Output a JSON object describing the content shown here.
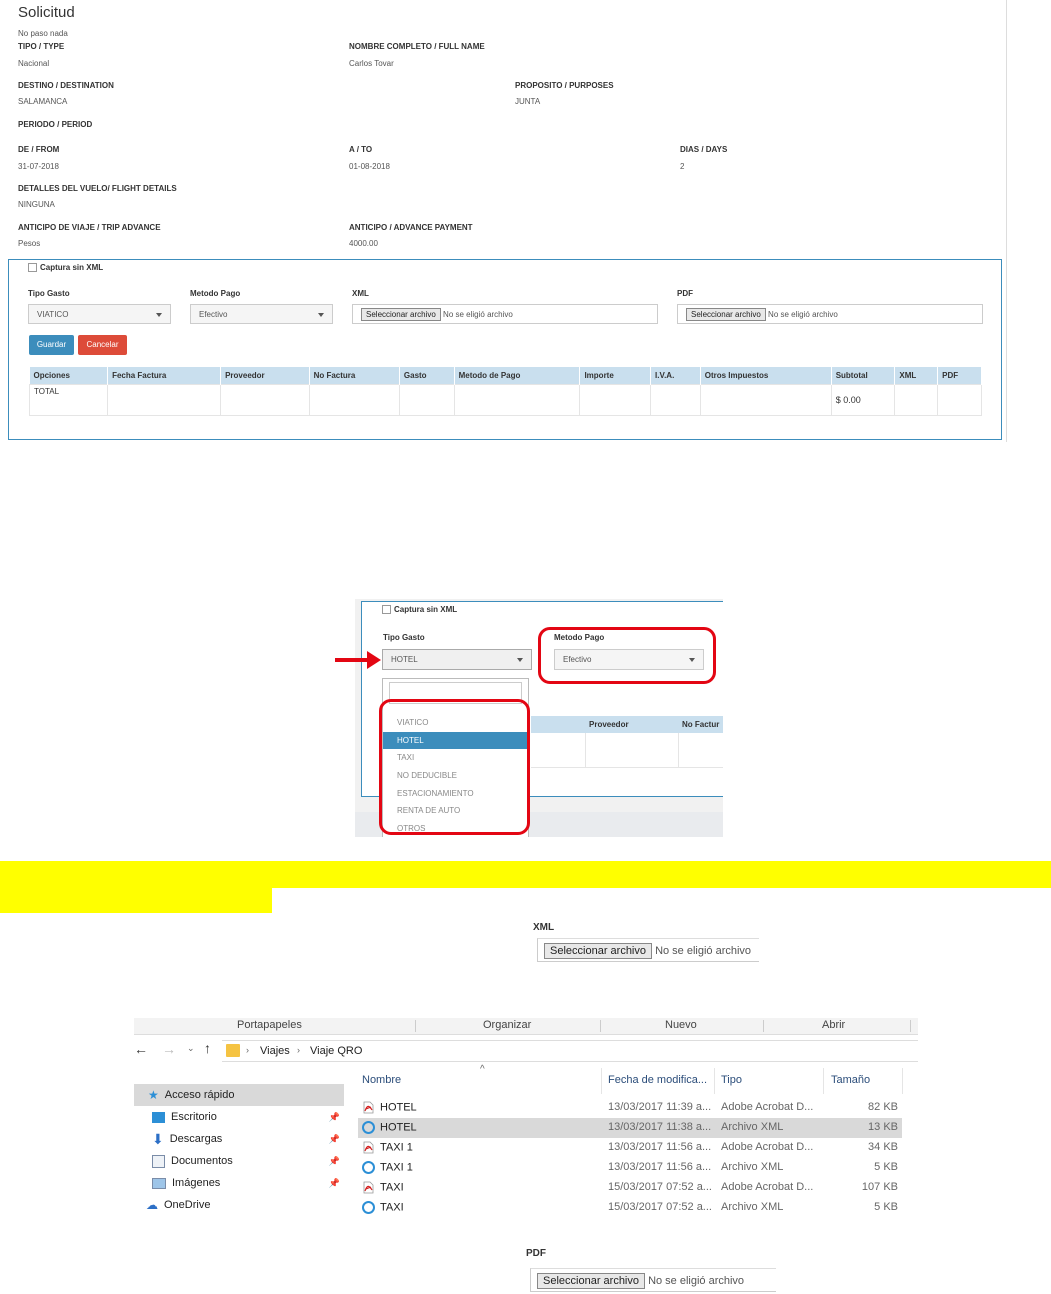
{
  "form": {
    "title": "Solicitud",
    "note": "No paso nada",
    "fields": {
      "type_label": "TIPO / TYPE",
      "type_value": "Nacional",
      "name_label": "NOMBRE COMPLETO / FULL NAME",
      "name_value": "Carlos Tovar",
      "dest_label": "DESTINO / DESTINATION",
      "dest_value": "SALAMANCA",
      "purpose_label": "PROPOSITO / PURPOSES",
      "purpose_value": "JUNTA",
      "period_label": "PERIODO / PERIOD",
      "from_label": "DE / FROM",
      "from_value": "31-07-2018",
      "to_label": "A / TO",
      "to_value": "01-08-2018",
      "days_label": "DIAS / DAYS",
      "days_value": "2",
      "flight_label": "DETALLES DEL VUELO/ FLIGHT DETAILS",
      "flight_value": "NINGUNA",
      "advance_label": "ANTICIPO DE VIAJE / TRIP ADVANCE",
      "advance_value": "Pesos",
      "advpay_label": "ANTICIPO / ADVANCE PAYMENT",
      "advpay_value": "4000.00"
    },
    "capture_label": "Captura sin XML",
    "tipo_gasto_label": "Tipo Gasto",
    "tipo_gasto_value": "VIATICO",
    "metodo_pago_label": "Metodo Pago",
    "metodo_pago_value": "Efectivo",
    "xml_label": "XML",
    "pdf_label": "PDF",
    "file_button": "Seleccionar archivo",
    "no_file": "No se eligió archivo",
    "save_button": "Guardar",
    "cancel_button": "Cancelar",
    "table_headers": [
      "Opciones",
      "Fecha Factura",
      "Proveedor",
      "No Factura",
      "Gasto",
      "Metodo de Pago",
      "Importe",
      "I.V.A.",
      "Otros Impuestos",
      "Subtotal",
      "XML",
      "PDF"
    ],
    "total_label": "TOTAL",
    "subtotal_value": "$ 0.00"
  },
  "zoom": {
    "capture_label": "Captura sin XML",
    "tipo_gasto_label": "Tipo Gasto",
    "tipo_gasto_value": "HOTEL",
    "metodo_pago_label": "Metodo Pago",
    "metodo_pago_value": "Efectivo",
    "options": [
      "VIATICO",
      "HOTEL",
      "TAXI",
      "NO DEDUCIBLE",
      "ESTACIONAMIENTO",
      "RENTA DE AUTO",
      "OTROS"
    ],
    "selected": "HOTEL",
    "col_proveedor": "Proveedor",
    "col_nofactura": "No Factur"
  },
  "xml_control": {
    "label": "XML",
    "button": "Seleccionar archivo",
    "status": "No se eligió archivo"
  },
  "pdf_control": {
    "label": "PDF",
    "button": "Seleccionar archivo",
    "status": "No se eligió archivo"
  },
  "explorer": {
    "ribbon": [
      "Portapapeles",
      "Organizar",
      "Nuevo",
      "Abrir"
    ],
    "path": [
      "Viajes",
      "Viaje QRO"
    ],
    "sidebar": [
      "Acceso rápido",
      "Escritorio",
      "Descargas",
      "Documentos",
      "Imágenes",
      "OneDrive"
    ],
    "columns": [
      "Nombre",
      "Fecha de modifica...",
      "Tipo",
      "Tamaño"
    ],
    "files": [
      {
        "name": "HOTEL",
        "date": "13/03/2017 11:39 a...",
        "type": "Adobe Acrobat D...",
        "size": "82 KB",
        "icon": "pdf-icon"
      },
      {
        "name": "HOTEL",
        "date": "13/03/2017 11:38 a...",
        "type": "Archivo XML",
        "size": "13 KB",
        "icon": "ie-xml-icon"
      },
      {
        "name": "TAXI 1",
        "date": "13/03/2017 11:56 a...",
        "type": "Adobe Acrobat D...",
        "size": "34 KB",
        "icon": "pdf-icon"
      },
      {
        "name": "TAXI 1",
        "date": "13/03/2017 11:56 a...",
        "type": "Archivo XML",
        "size": "5 KB",
        "icon": "ie-xml-icon"
      },
      {
        "name": "TAXI",
        "date": "15/03/2017 07:52 a...",
        "type": "Adobe Acrobat D...",
        "size": "107 KB",
        "icon": "pdf-icon"
      },
      {
        "name": "TAXI",
        "date": "15/03/2017 07:52 a...",
        "type": "Archivo XML",
        "size": "5 KB",
        "icon": "ie-xml-icon"
      }
    ],
    "selected_row": 1
  },
  "colors": {
    "primary": "#3c8dbc",
    "danger": "#dd4b39",
    "annotation_red": "#e30613",
    "highlight": "#ffff00",
    "table_header": "#c9dfee"
  }
}
